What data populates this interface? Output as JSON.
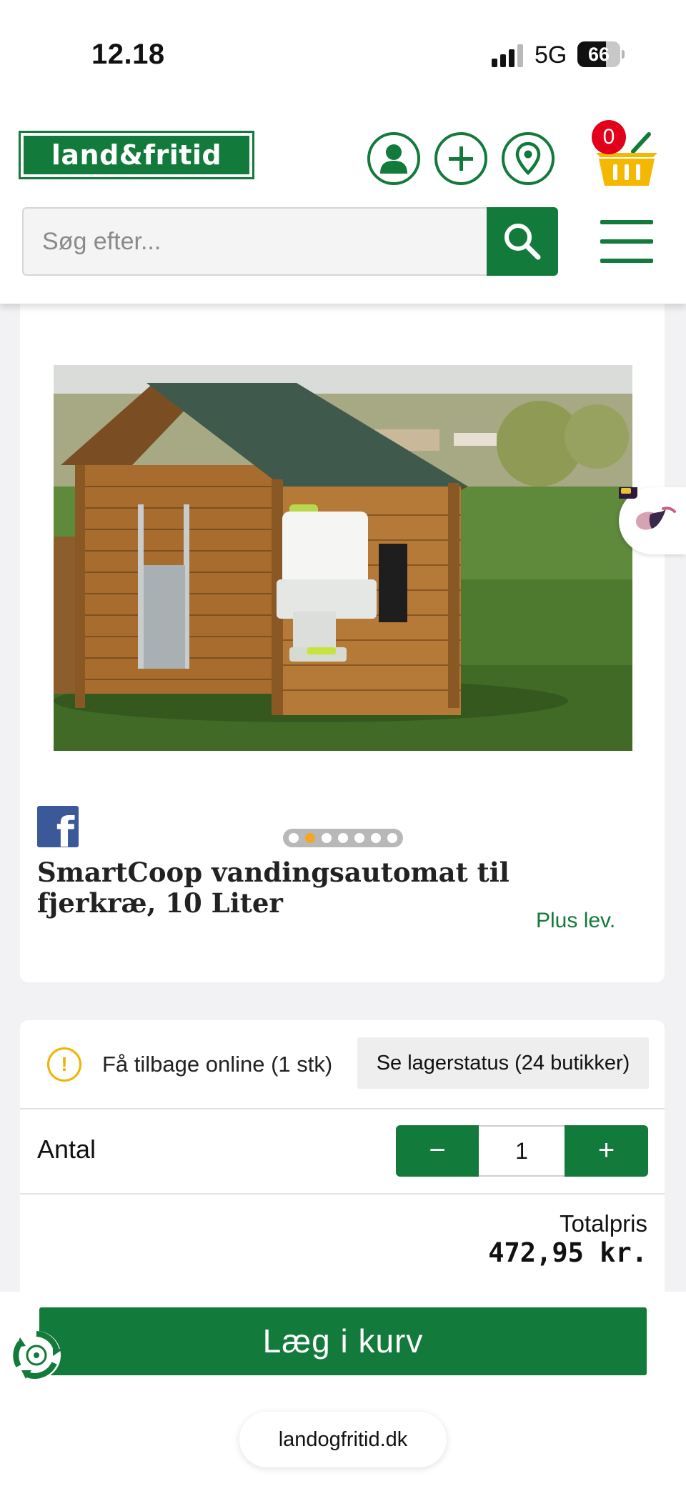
{
  "status_bar": {
    "time": "12.18",
    "network": "5G",
    "battery": "66",
    "battery_level": 0.66
  },
  "header": {
    "logo_text": "land&fritid",
    "cart_count": "0",
    "search_placeholder": "Søg efter..."
  },
  "product": {
    "title": "SmartCoop vandingsautomat til fjerkræ, 10 Liter",
    "delivery": "Plus lev.",
    "image_count": 7,
    "active_image": 2
  },
  "purchase": {
    "stock_message": "Få tilbage online (1 stk)",
    "stock_button": "Se lagerstatus (24 butikker)",
    "quantity_label": "Antal",
    "quantity": "1",
    "minus": "−",
    "plus": "+",
    "total_label": "Totalpris",
    "total_price": "472,95 kr.",
    "add_to_cart": "Læg i kurv"
  },
  "browser": {
    "url": "landogfritid.dk"
  },
  "colors": {
    "brand_green": "#127a3a",
    "badge_red": "#e3001b",
    "basket_yellow": "#f5b800",
    "warning_yellow": "#f0b400"
  },
  "icons": [
    "account-icon",
    "add-icon",
    "store-location-icon",
    "basket-icon",
    "search-icon",
    "menu-icon",
    "facebook-icon",
    "warning-icon",
    "recycle-icon"
  ]
}
